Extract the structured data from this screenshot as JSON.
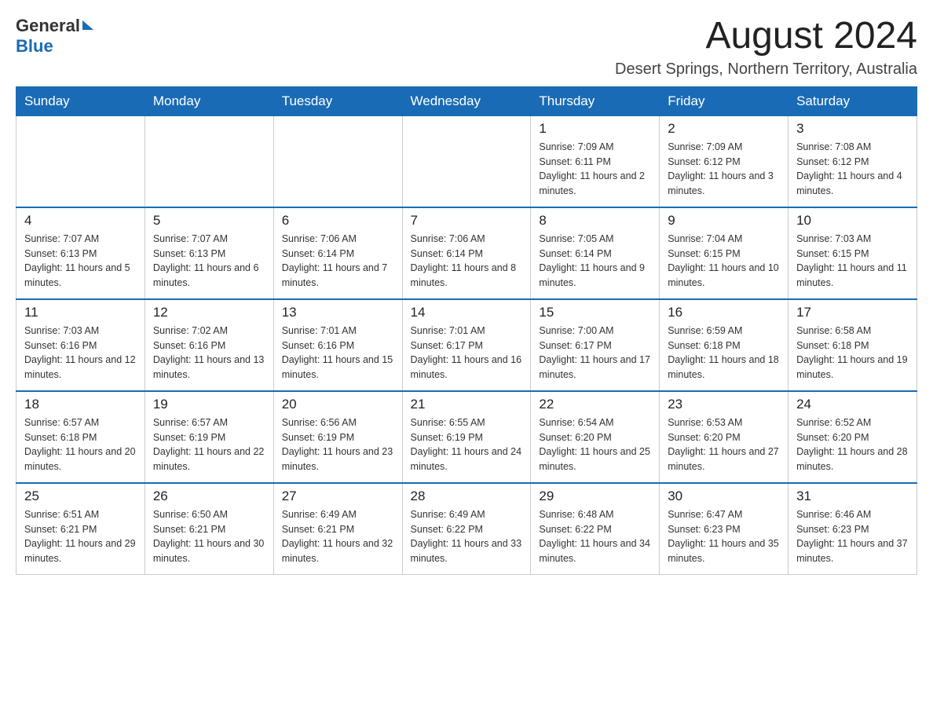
{
  "header": {
    "logo_general": "General",
    "logo_blue": "Blue",
    "month_title": "August 2024",
    "location": "Desert Springs, Northern Territory, Australia"
  },
  "days_of_week": [
    "Sunday",
    "Monday",
    "Tuesday",
    "Wednesday",
    "Thursday",
    "Friday",
    "Saturday"
  ],
  "weeks": [
    {
      "cells": [
        {
          "day": "",
          "info": ""
        },
        {
          "day": "",
          "info": ""
        },
        {
          "day": "",
          "info": ""
        },
        {
          "day": "",
          "info": ""
        },
        {
          "day": "1",
          "info": "Sunrise: 7:09 AM\nSunset: 6:11 PM\nDaylight: 11 hours and 2 minutes."
        },
        {
          "day": "2",
          "info": "Sunrise: 7:09 AM\nSunset: 6:12 PM\nDaylight: 11 hours and 3 minutes."
        },
        {
          "day": "3",
          "info": "Sunrise: 7:08 AM\nSunset: 6:12 PM\nDaylight: 11 hours and 4 minutes."
        }
      ]
    },
    {
      "cells": [
        {
          "day": "4",
          "info": "Sunrise: 7:07 AM\nSunset: 6:13 PM\nDaylight: 11 hours and 5 minutes."
        },
        {
          "day": "5",
          "info": "Sunrise: 7:07 AM\nSunset: 6:13 PM\nDaylight: 11 hours and 6 minutes."
        },
        {
          "day": "6",
          "info": "Sunrise: 7:06 AM\nSunset: 6:14 PM\nDaylight: 11 hours and 7 minutes."
        },
        {
          "day": "7",
          "info": "Sunrise: 7:06 AM\nSunset: 6:14 PM\nDaylight: 11 hours and 8 minutes."
        },
        {
          "day": "8",
          "info": "Sunrise: 7:05 AM\nSunset: 6:14 PM\nDaylight: 11 hours and 9 minutes."
        },
        {
          "day": "9",
          "info": "Sunrise: 7:04 AM\nSunset: 6:15 PM\nDaylight: 11 hours and 10 minutes."
        },
        {
          "day": "10",
          "info": "Sunrise: 7:03 AM\nSunset: 6:15 PM\nDaylight: 11 hours and 11 minutes."
        }
      ]
    },
    {
      "cells": [
        {
          "day": "11",
          "info": "Sunrise: 7:03 AM\nSunset: 6:16 PM\nDaylight: 11 hours and 12 minutes."
        },
        {
          "day": "12",
          "info": "Sunrise: 7:02 AM\nSunset: 6:16 PM\nDaylight: 11 hours and 13 minutes."
        },
        {
          "day": "13",
          "info": "Sunrise: 7:01 AM\nSunset: 6:16 PM\nDaylight: 11 hours and 15 minutes."
        },
        {
          "day": "14",
          "info": "Sunrise: 7:01 AM\nSunset: 6:17 PM\nDaylight: 11 hours and 16 minutes."
        },
        {
          "day": "15",
          "info": "Sunrise: 7:00 AM\nSunset: 6:17 PM\nDaylight: 11 hours and 17 minutes."
        },
        {
          "day": "16",
          "info": "Sunrise: 6:59 AM\nSunset: 6:18 PM\nDaylight: 11 hours and 18 minutes."
        },
        {
          "day": "17",
          "info": "Sunrise: 6:58 AM\nSunset: 6:18 PM\nDaylight: 11 hours and 19 minutes."
        }
      ]
    },
    {
      "cells": [
        {
          "day": "18",
          "info": "Sunrise: 6:57 AM\nSunset: 6:18 PM\nDaylight: 11 hours and 20 minutes."
        },
        {
          "day": "19",
          "info": "Sunrise: 6:57 AM\nSunset: 6:19 PM\nDaylight: 11 hours and 22 minutes."
        },
        {
          "day": "20",
          "info": "Sunrise: 6:56 AM\nSunset: 6:19 PM\nDaylight: 11 hours and 23 minutes."
        },
        {
          "day": "21",
          "info": "Sunrise: 6:55 AM\nSunset: 6:19 PM\nDaylight: 11 hours and 24 minutes."
        },
        {
          "day": "22",
          "info": "Sunrise: 6:54 AM\nSunset: 6:20 PM\nDaylight: 11 hours and 25 minutes."
        },
        {
          "day": "23",
          "info": "Sunrise: 6:53 AM\nSunset: 6:20 PM\nDaylight: 11 hours and 27 minutes."
        },
        {
          "day": "24",
          "info": "Sunrise: 6:52 AM\nSunset: 6:20 PM\nDaylight: 11 hours and 28 minutes."
        }
      ]
    },
    {
      "cells": [
        {
          "day": "25",
          "info": "Sunrise: 6:51 AM\nSunset: 6:21 PM\nDaylight: 11 hours and 29 minutes."
        },
        {
          "day": "26",
          "info": "Sunrise: 6:50 AM\nSunset: 6:21 PM\nDaylight: 11 hours and 30 minutes."
        },
        {
          "day": "27",
          "info": "Sunrise: 6:49 AM\nSunset: 6:21 PM\nDaylight: 11 hours and 32 minutes."
        },
        {
          "day": "28",
          "info": "Sunrise: 6:49 AM\nSunset: 6:22 PM\nDaylight: 11 hours and 33 minutes."
        },
        {
          "day": "29",
          "info": "Sunrise: 6:48 AM\nSunset: 6:22 PM\nDaylight: 11 hours and 34 minutes."
        },
        {
          "day": "30",
          "info": "Sunrise: 6:47 AM\nSunset: 6:23 PM\nDaylight: 11 hours and 35 minutes."
        },
        {
          "day": "31",
          "info": "Sunrise: 6:46 AM\nSunset: 6:23 PM\nDaylight: 11 hours and 37 minutes."
        }
      ]
    }
  ]
}
